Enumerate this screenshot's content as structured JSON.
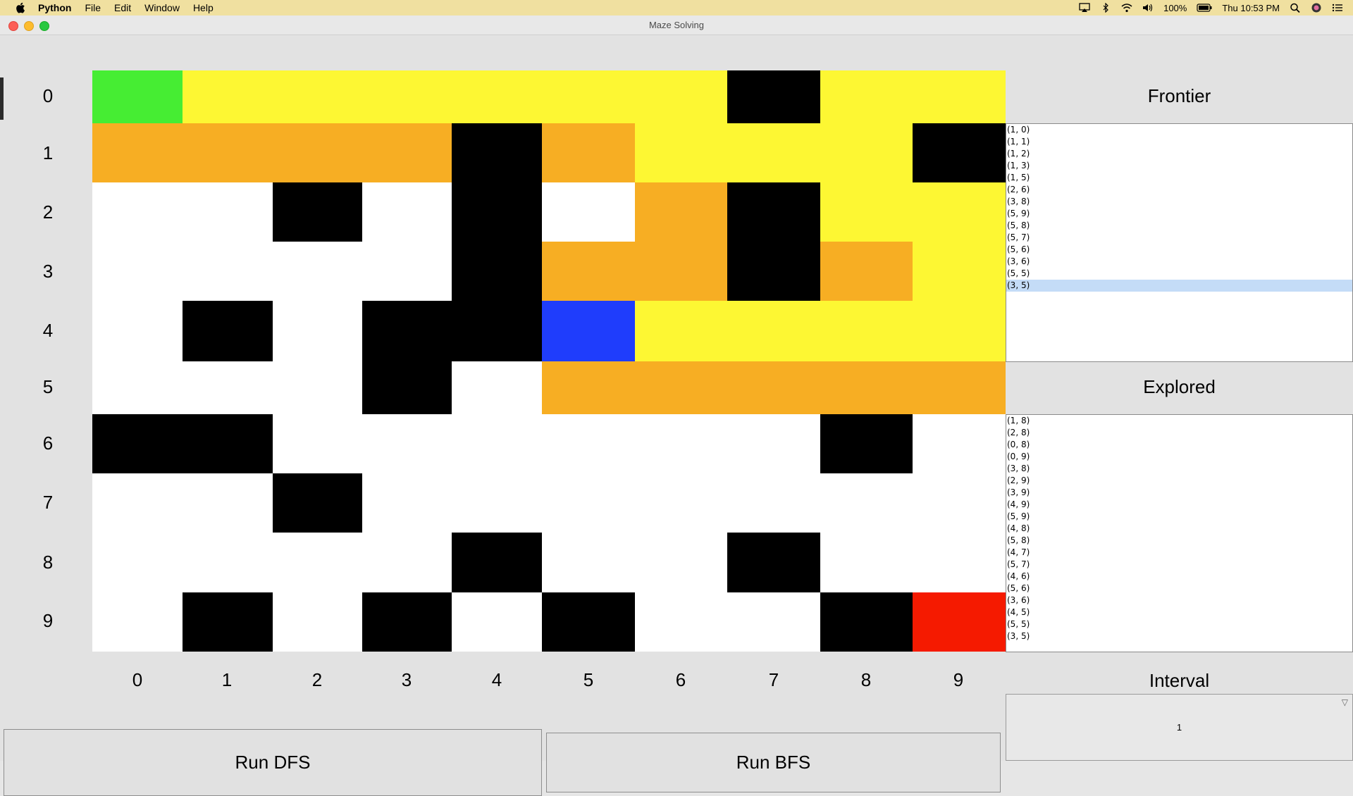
{
  "menubar": {
    "items": [
      "Python",
      "File",
      "Edit",
      "Window",
      "Help"
    ],
    "battery": "100%",
    "clock": "Thu 10:53 PM"
  },
  "window": {
    "title": "Maze Solving"
  },
  "grid": {
    "row_labels": [
      "0",
      "1",
      "2",
      "3",
      "4",
      "5",
      "6",
      "7",
      "8",
      "9"
    ],
    "col_labels": [
      "0",
      "1",
      "2",
      "3",
      "4",
      "5",
      "6",
      "7",
      "8",
      "9"
    ],
    "legend_colors": {
      "W": "#ffffff",
      "B": "#000000",
      "Y": "#fdf733",
      "O": "#f7ae23",
      "G": "#46ed33",
      "U": "#1f3dfc",
      "R": "#f51a00"
    },
    "cells": [
      [
        "G",
        "Y",
        "Y",
        "Y",
        "Y",
        "Y",
        "Y",
        "B",
        "Y",
        "Y"
      ],
      [
        "O",
        "O",
        "O",
        "O",
        "B",
        "O",
        "Y",
        "Y",
        "Y",
        "B"
      ],
      [
        "W",
        "W",
        "B",
        "W",
        "B",
        "W",
        "O",
        "B",
        "Y",
        "Y"
      ],
      [
        "W",
        "W",
        "W",
        "W",
        "B",
        "O",
        "O",
        "B",
        "O",
        "Y"
      ],
      [
        "W",
        "B",
        "W",
        "B",
        "B",
        "U",
        "Y",
        "Y",
        "Y",
        "Y"
      ],
      [
        "W",
        "W",
        "W",
        "B",
        "W",
        "O",
        "O",
        "O",
        "O",
        "O"
      ],
      [
        "B",
        "B",
        "W",
        "W",
        "W",
        "W",
        "W",
        "W",
        "B",
        "W"
      ],
      [
        "W",
        "W",
        "B",
        "W",
        "W",
        "W",
        "W",
        "W",
        "W",
        "W"
      ],
      [
        "W",
        "W",
        "W",
        "W",
        "B",
        "W",
        "W",
        "B",
        "W",
        "W"
      ],
      [
        "W",
        "B",
        "W",
        "B",
        "W",
        "B",
        "W",
        "W",
        "B",
        "R"
      ]
    ]
  },
  "frontier": {
    "title": "Frontier",
    "items": [
      "(1, 0)",
      "(1, 1)",
      "(1, 2)",
      "(1, 3)",
      "(1, 5)",
      "(2, 6)",
      "(3, 8)",
      "(5, 9)",
      "(5, 8)",
      "(5, 7)",
      "(5, 6)",
      "(3, 6)",
      "(5, 5)",
      "(3, 5)"
    ],
    "selected_index": 13
  },
  "explored": {
    "title": "Explored",
    "items": [
      "(1, 8)",
      "(2, 8)",
      "(0, 8)",
      "(0, 9)",
      "(3, 8)",
      "(2, 9)",
      "(3, 9)",
      "(4, 9)",
      "(5, 9)",
      "(4, 8)",
      "(5, 8)",
      "(4, 7)",
      "(5, 7)",
      "(4, 6)",
      "(5, 6)",
      "(3, 6)",
      "(4, 5)",
      "(5, 5)",
      "(3, 5)"
    ]
  },
  "controls": {
    "run_dfs": "Run DFS",
    "run_bfs": "Run BFS",
    "interval_label": "Interval",
    "interval_value": "1"
  }
}
